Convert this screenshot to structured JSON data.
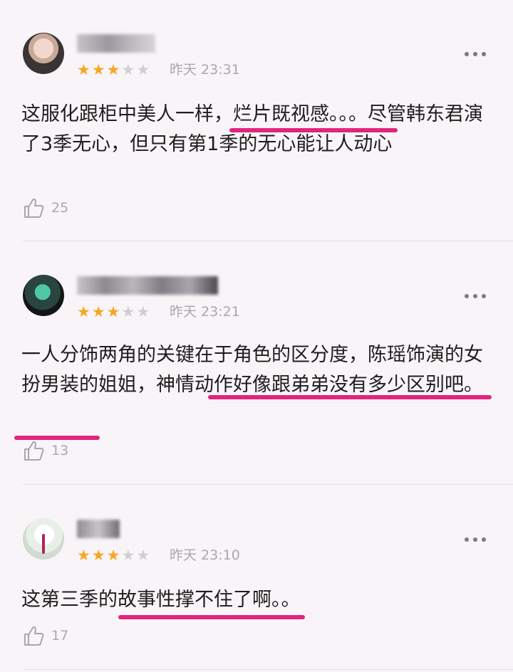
{
  "comments": [
    {
      "stars_filled": 3,
      "stars_total": 5,
      "date": "昨天 23:31",
      "text": "这服化跟柜中美人一样，烂片既视感。。。尽管韩东君演了3季无心，但只有第1季的无心能让人动心",
      "likes": "25"
    },
    {
      "stars_filled": 3,
      "stars_total": 5,
      "date": "昨天 23:21",
      "text": "一人分饰两角的关键在于角色的区分度，陈瑶饰演的女扮男装的姐姐，神情动作好像跟弟弟没有多少区别吧。",
      "likes": "13"
    },
    {
      "stars_filled": 3,
      "stars_total": 5,
      "date": "昨天 23:10",
      "text": "这第三季的故事性撑不住了啊。。",
      "likes": "17"
    }
  ],
  "icons": {
    "avatar": "avatar-icon",
    "more": "more-dots-icon",
    "star": "star-icon",
    "like": "thumbs-up-icon"
  },
  "colors": {
    "background": "#f8f4f8",
    "star_on": "#f6a623",
    "star_off": "#cfcfcf",
    "highlight_underline": "#e2257c",
    "meta_text": "#a9a9a9"
  }
}
